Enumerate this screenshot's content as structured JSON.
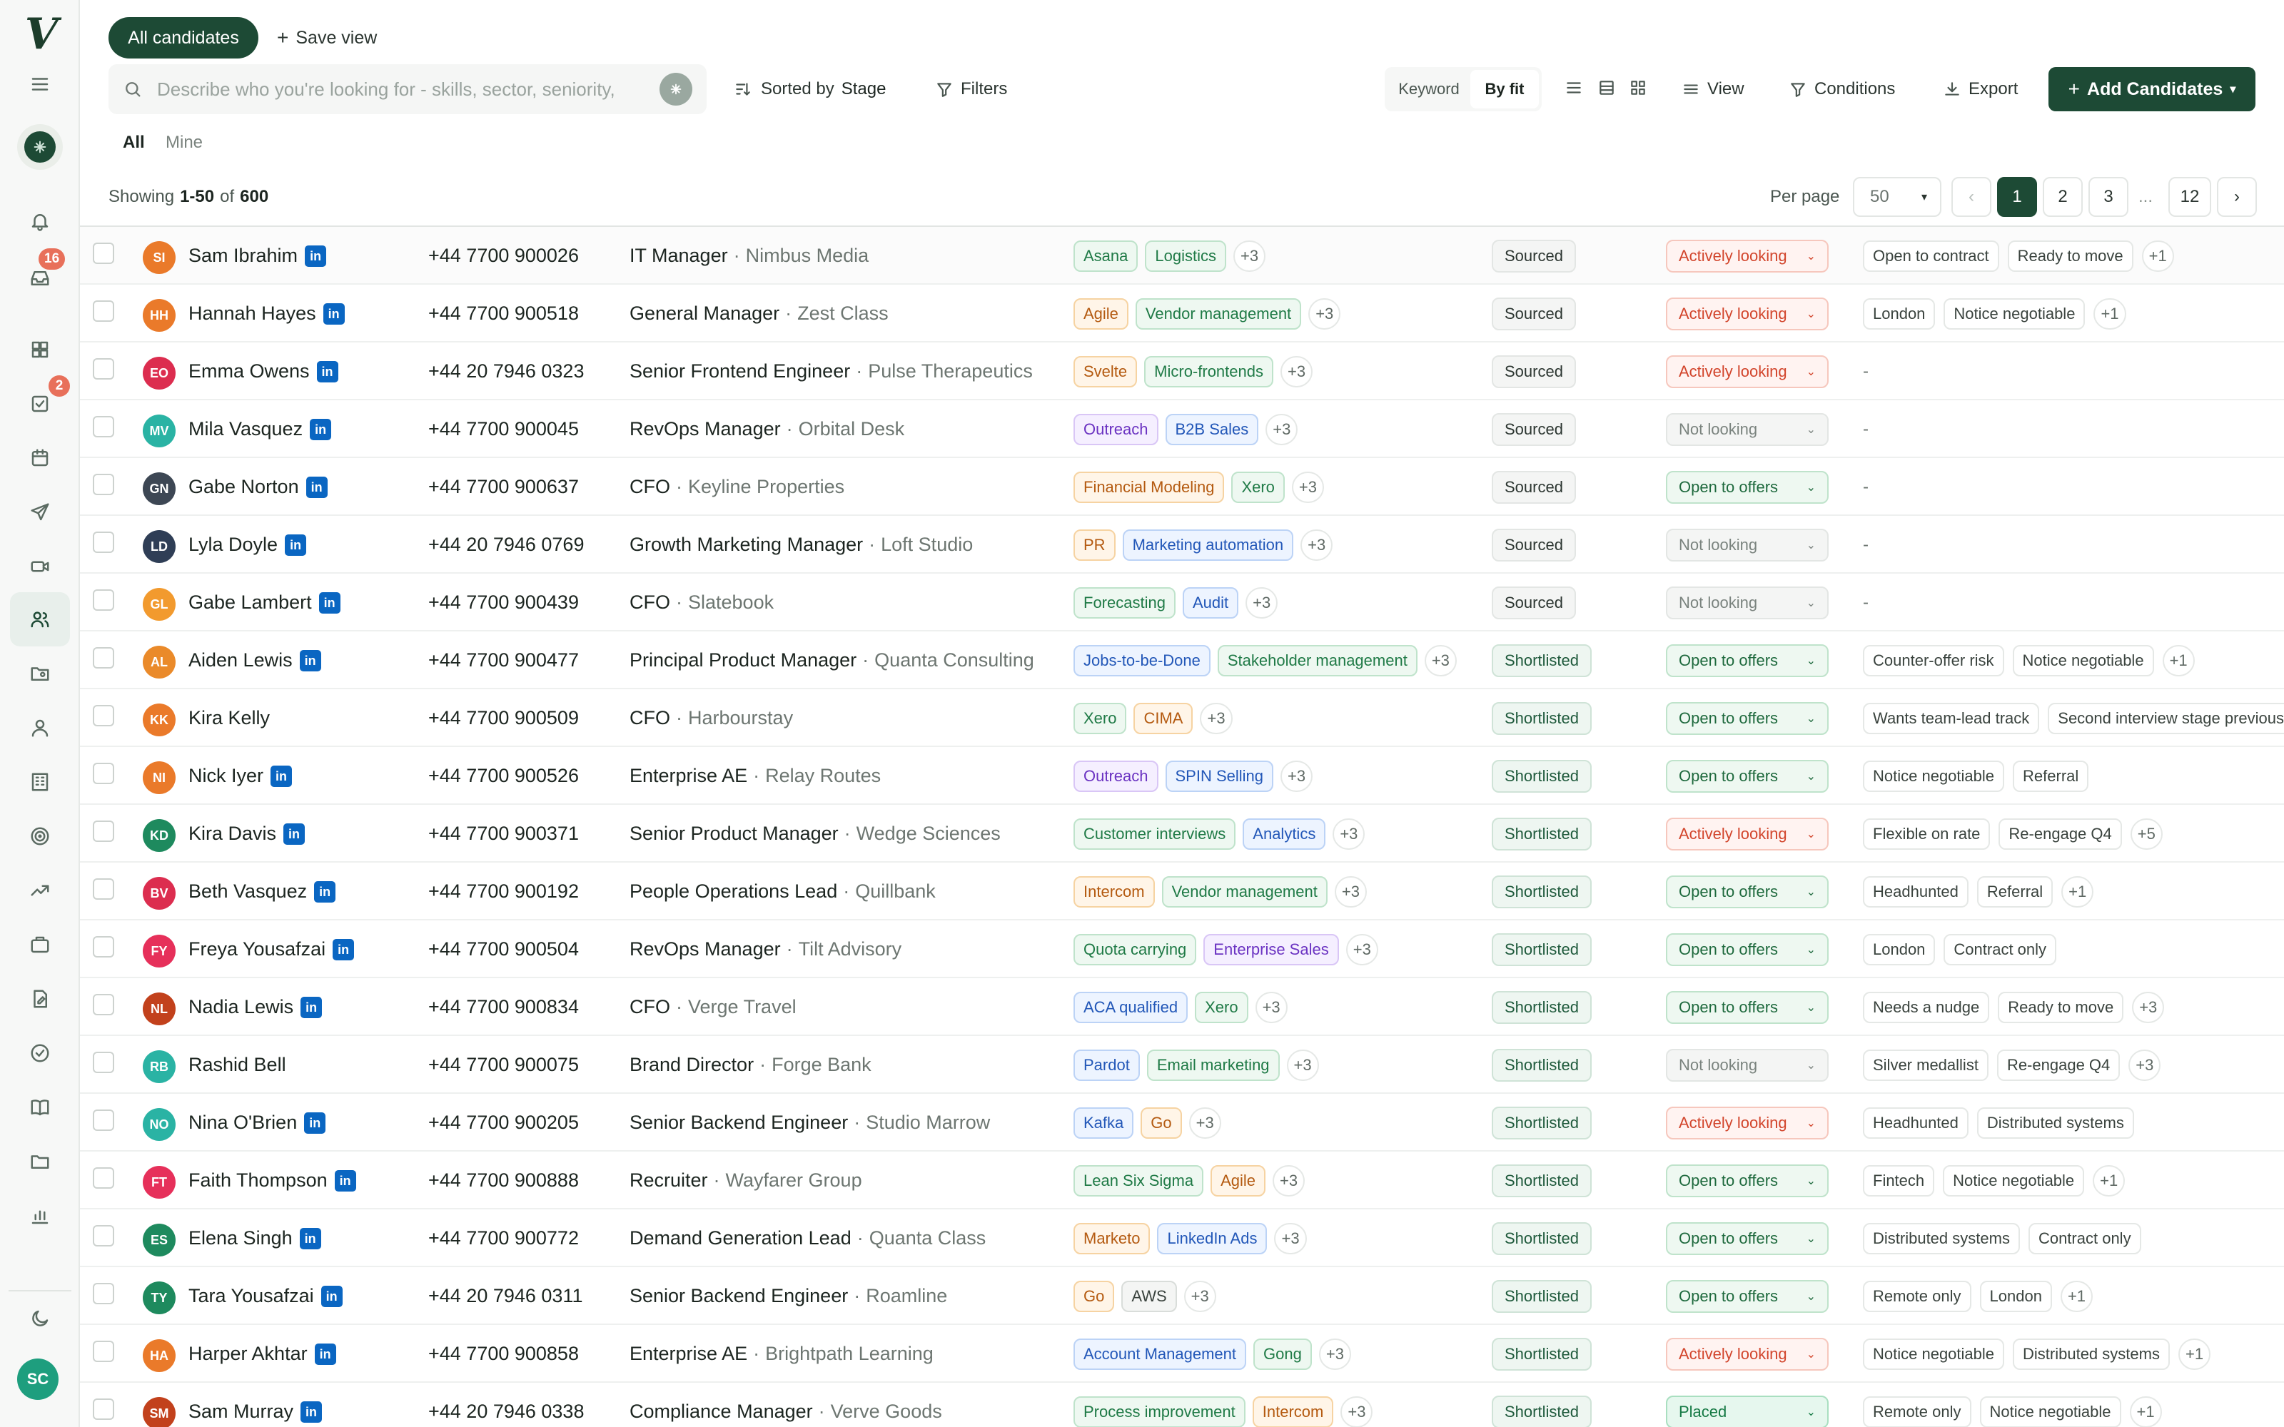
{
  "app": {
    "logo": "V"
  },
  "sidebar": {
    "inbox_badge": "16",
    "tasks_badge": "2",
    "user_initials": "SC"
  },
  "header": {
    "tab_all_candidates": "All candidates",
    "save_view": "Save view",
    "search_placeholder": "Describe who you're looking for - skills, sector, seniority,",
    "sorted_by_label": "Sorted by",
    "sorted_by_value": "Stage",
    "filters": "Filters",
    "mode_keyword": "Keyword",
    "mode_by_fit": "By fit",
    "view": "View",
    "conditions": "Conditions",
    "export": "Export",
    "add_candidates": "Add Candidates",
    "subtab_all": "All",
    "subtab_mine": "Mine"
  },
  "summary": {
    "showing_prefix": "Showing",
    "range": "1-50",
    "of": "of",
    "total": "600"
  },
  "pagination": {
    "per_page_label": "Per page",
    "per_page_value": "50",
    "pages": [
      "1",
      "2",
      "3"
    ],
    "ellipsis": "...",
    "last": "12",
    "prev": "‹",
    "next": "›"
  },
  "colors": {
    "accent": "#1d4a35",
    "linkedin": "#0a66c2"
  },
  "candidates": [
    {
      "initials": "SI",
      "color": "#ea7a2a",
      "name": "Sam Ibrahim",
      "li": true,
      "phone": "+44 7700 900026",
      "title": "IT Manager",
      "company": "Nimbus Media",
      "skills": [
        [
          "Asana",
          "green"
        ],
        [
          "Logistics",
          "green"
        ]
      ],
      "skills_more": "+3",
      "stage": "Sourced",
      "status": "Actively looking",
      "notes": [
        "Open to contract",
        "Ready to move"
      ],
      "notes_more": "+1"
    },
    {
      "initials": "HH",
      "color": "#ea7a2a",
      "name": "Hannah Hayes",
      "li": true,
      "phone": "+44 7700 900518",
      "title": "General Manager",
      "company": "Zest Class",
      "skills": [
        [
          "Agile",
          "orange"
        ],
        [
          "Vendor management",
          "green"
        ]
      ],
      "skills_more": "+3",
      "stage": "Sourced",
      "status": "Actively looking",
      "notes": [
        "London",
        "Notice negotiable"
      ],
      "notes_more": "+1"
    },
    {
      "initials": "EO",
      "color": "#dc2d4f",
      "name": "Emma Owens",
      "li": true,
      "phone": "+44 20 7946 0323",
      "title": "Senior Frontend Engineer",
      "company": "Pulse Therapeutics",
      "skills": [
        [
          "Svelte",
          "orange"
        ],
        [
          "Micro-frontends",
          "green"
        ]
      ],
      "skills_more": "+3",
      "stage": "Sourced",
      "status": "Actively looking",
      "notes": [],
      "notes_more": ""
    },
    {
      "initials": "MV",
      "color": "#2ab3a4",
      "name": "Mila Vasquez",
      "li": true,
      "phone": "+44 7700 900045",
      "title": "RevOps Manager",
      "company": "Orbital Desk",
      "skills": [
        [
          "Outreach",
          "purple"
        ],
        [
          "B2B Sales",
          "blue"
        ]
      ],
      "skills_more": "+3",
      "stage": "Sourced",
      "status": "Not looking",
      "notes": [],
      "notes_more": ""
    },
    {
      "initials": "GN",
      "color": "#3d4754",
      "name": "Gabe Norton",
      "li": true,
      "phone": "+44 7700 900637",
      "title": "CFO",
      "company": "Keyline Properties",
      "skills": [
        [
          "Financial Modeling",
          "orange"
        ],
        [
          "Xero",
          "green"
        ]
      ],
      "skills_more": "+3",
      "stage": "Sourced",
      "status": "Open to offers",
      "notes": [],
      "notes_more": ""
    },
    {
      "initials": "LD",
      "color": "#2f3e56",
      "name": "Lyla Doyle",
      "li": true,
      "phone": "+44 20 7946 0769",
      "title": "Growth Marketing Manager",
      "company": "Loft Studio",
      "skills": [
        [
          "PR",
          "orange"
        ],
        [
          "Marketing automation",
          "blue"
        ]
      ],
      "skills_more": "+3",
      "stage": "Sourced",
      "status": "Not looking",
      "notes": [],
      "notes_more": ""
    },
    {
      "initials": "GL",
      "color": "#f29a2e",
      "name": "Gabe Lambert",
      "li": true,
      "phone": "+44 7700 900439",
      "title": "CFO",
      "company": "Slatebook",
      "skills": [
        [
          "Forecasting",
          "green"
        ],
        [
          "Audit",
          "blue"
        ]
      ],
      "skills_more": "+3",
      "stage": "Sourced",
      "status": "Not looking",
      "notes": [],
      "notes_more": ""
    },
    {
      "initials": "AL",
      "color": "#ea8a2a",
      "name": "Aiden Lewis",
      "li": true,
      "phone": "+44 7700 900477",
      "title": "Principal Product Manager",
      "company": "Quanta Consulting",
      "skills": [
        [
          "Jobs-to-be-Done",
          "blue"
        ],
        [
          "Stakeholder management",
          "green"
        ]
      ],
      "skills_more": "+3",
      "stage": "Shortlisted",
      "status": "Open to offers",
      "notes": [
        "Counter-offer risk",
        "Notice negotiable"
      ],
      "notes_more": "+1"
    },
    {
      "initials": "KK",
      "color": "#ea7a2a",
      "name": "Kira Kelly",
      "li": false,
      "phone": "+44 7700 900509",
      "title": "CFO",
      "company": "Harbourstay",
      "skills": [
        [
          "Xero",
          "green"
        ],
        [
          "CIMA",
          "orange"
        ]
      ],
      "skills_more": "+3",
      "stage": "Shortlisted",
      "status": "Open to offers",
      "notes": [
        "Wants team-lead track",
        "Second interview stage previously"
      ],
      "notes_more": ""
    },
    {
      "initials": "NI",
      "color": "#ea7a2a",
      "name": "Nick Iyer",
      "li": true,
      "phone": "+44 7700 900526",
      "title": "Enterprise AE",
      "company": "Relay Routes",
      "skills": [
        [
          "Outreach",
          "purple"
        ],
        [
          "SPIN Selling",
          "blue"
        ]
      ],
      "skills_more": "+3",
      "stage": "Shortlisted",
      "status": "Open to offers",
      "notes": [
        "Notice negotiable",
        "Referral"
      ],
      "notes_more": ""
    },
    {
      "initials": "KD",
      "color": "#1e8a5e",
      "name": "Kira Davis",
      "li": true,
      "phone": "+44 7700 900371",
      "title": "Senior Product Manager",
      "company": "Wedge Sciences",
      "skills": [
        [
          "Customer interviews",
          "green"
        ],
        [
          "Analytics",
          "blue"
        ]
      ],
      "skills_more": "+3",
      "stage": "Shortlisted",
      "status": "Actively looking",
      "notes": [
        "Flexible on rate",
        "Re-engage Q4"
      ],
      "notes_more": "+5"
    },
    {
      "initials": "BV",
      "color": "#dc2d4f",
      "name": "Beth Vasquez",
      "li": true,
      "phone": "+44 7700 900192",
      "title": "People Operations Lead",
      "company": "Quillbank",
      "skills": [
        [
          "Intercom",
          "orange"
        ],
        [
          "Vendor management",
          "green"
        ]
      ],
      "skills_more": "+3",
      "stage": "Shortlisted",
      "status": "Open to offers",
      "notes": [
        "Headhunted",
        "Referral"
      ],
      "notes_more": "+1"
    },
    {
      "initials": "FY",
      "color": "#e6305a",
      "name": "Freya Yousafzai",
      "li": true,
      "phone": "+44 7700 900504",
      "title": "RevOps Manager",
      "company": "Tilt Advisory",
      "skills": [
        [
          "Quota carrying",
          "green"
        ],
        [
          "Enterprise Sales",
          "purple"
        ]
      ],
      "skills_more": "+3",
      "stage": "Shortlisted",
      "status": "Open to offers",
      "notes": [
        "London",
        "Contract only"
      ],
      "notes_more": ""
    },
    {
      "initials": "NL",
      "color": "#c2411c",
      "name": "Nadia Lewis",
      "li": true,
      "phone": "+44 7700 900834",
      "title": "CFO",
      "company": "Verge Travel",
      "skills": [
        [
          "ACA qualified",
          "blue"
        ],
        [
          "Xero",
          "green"
        ]
      ],
      "skills_more": "+3",
      "stage": "Shortlisted",
      "status": "Open to offers",
      "notes": [
        "Needs a nudge",
        "Ready to move"
      ],
      "notes_more": "+3"
    },
    {
      "initials": "RB",
      "color": "#2ab3a4",
      "name": "Rashid Bell",
      "li": false,
      "phone": "+44 7700 900075",
      "title": "Brand Director",
      "company": "Forge Bank",
      "skills": [
        [
          "Pardot",
          "blue"
        ],
        [
          "Email marketing",
          "green"
        ]
      ],
      "skills_more": "+3",
      "stage": "Shortlisted",
      "status": "Not looking",
      "notes": [
        "Silver medallist",
        "Re-engage Q4"
      ],
      "notes_more": "+3"
    },
    {
      "initials": "NO",
      "color": "#2ab3a4",
      "name": "Nina O'Brien",
      "li": true,
      "phone": "+44 7700 900205",
      "title": "Senior Backend Engineer",
      "company": "Studio Marrow",
      "skills": [
        [
          "Kafka",
          "blue"
        ],
        [
          "Go",
          "orange"
        ]
      ],
      "skills_more": "+3",
      "stage": "Shortlisted",
      "status": "Actively looking",
      "notes": [
        "Headhunted",
        "Distributed systems"
      ],
      "notes_more": ""
    },
    {
      "initials": "FT",
      "color": "#e6305a",
      "name": "Faith Thompson",
      "li": true,
      "phone": "+44 7700 900888",
      "title": "Recruiter",
      "company": "Wayfarer Group",
      "skills": [
        [
          "Lean Six Sigma",
          "green"
        ],
        [
          "Agile",
          "orange"
        ]
      ],
      "skills_more": "+3",
      "stage": "Shortlisted",
      "status": "Open to offers",
      "notes": [
        "Fintech",
        "Notice negotiable"
      ],
      "notes_more": "+1"
    },
    {
      "initials": "ES",
      "color": "#1e8a5e",
      "name": "Elena Singh",
      "li": true,
      "phone": "+44 7700 900772",
      "title": "Demand Generation Lead",
      "company": "Quanta Class",
      "skills": [
        [
          "Marketo",
          "orange"
        ],
        [
          "LinkedIn Ads",
          "blue"
        ]
      ],
      "skills_more": "+3",
      "stage": "Shortlisted",
      "status": "Open to offers",
      "notes": [
        "Distributed systems",
        "Contract only"
      ],
      "notes_more": ""
    },
    {
      "initials": "TY",
      "color": "#1e8a5e",
      "name": "Tara Yousafzai",
      "li": true,
      "phone": "+44 20 7946 0311",
      "title": "Senior Backend Engineer",
      "company": "Roamline",
      "skills": [
        [
          "Go",
          "orange"
        ],
        [
          "AWS",
          "gray"
        ]
      ],
      "skills_more": "+3",
      "stage": "Shortlisted",
      "status": "Open to offers",
      "notes": [
        "Remote only",
        "London"
      ],
      "notes_more": "+1"
    },
    {
      "initials": "HA",
      "color": "#ea7a2a",
      "name": "Harper Akhtar",
      "li": true,
      "phone": "+44 7700 900858",
      "title": "Enterprise AE",
      "company": "Brightpath Learning",
      "skills": [
        [
          "Account Management",
          "blue"
        ],
        [
          "Gong",
          "green"
        ]
      ],
      "skills_more": "+3",
      "stage": "Shortlisted",
      "status": "Actively looking",
      "notes": [
        "Notice negotiable",
        "Distributed systems"
      ],
      "notes_more": "+1"
    },
    {
      "initials": "SM",
      "color": "#c2411c",
      "name": "Sam Murray",
      "li": true,
      "phone": "+44 20 7946 0338",
      "title": "Compliance Manager",
      "company": "Verve Goods",
      "skills": [
        [
          "Process improvement",
          "green"
        ],
        [
          "Intercom",
          "orange"
        ]
      ],
      "skills_more": "+3",
      "stage": "Shortlisted",
      "status": "Placed",
      "notes": [
        "Remote only",
        "Notice negotiable"
      ],
      "notes_more": "+1"
    }
  ]
}
